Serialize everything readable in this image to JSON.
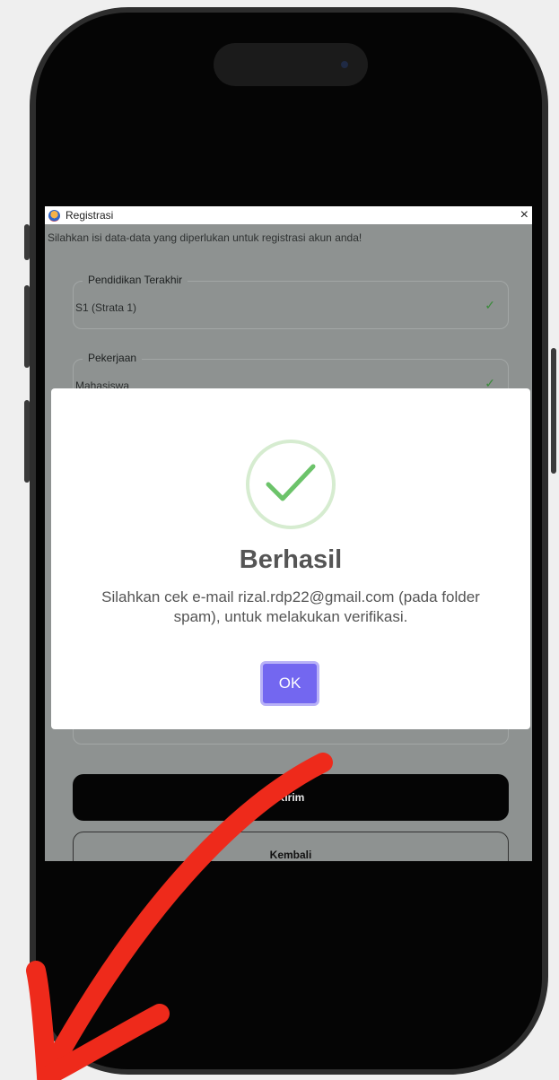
{
  "window": {
    "title": "Registrasi",
    "close_glyph": "×",
    "instruction": "Silahkan isi data-data yang diperlukan untuk registrasi akun anda!"
  },
  "form": {
    "fields": [
      {
        "label": "Pendidikan Terakhir",
        "value": "S1 (Strata 1)",
        "valid": true
      },
      {
        "label": "Pekerjaan",
        "value": "Mahasiswa",
        "valid": true
      }
    ],
    "check_glyph": "✓",
    "submit_label": "Kirim",
    "back_label": "Kembali"
  },
  "dialog": {
    "icon": "success-check-icon",
    "title": "Berhasil",
    "message": "Silahkan cek e-mail rizal.rdp22@gmail.com (pada folder spam), untuk melakukan verifikasi.",
    "ok_label": "OK"
  },
  "colors": {
    "overlay": "#8e9291",
    "dialog_button": "#7367f0",
    "success_green": "#6cc36a",
    "annotation_arrow": "#ee2a1b"
  }
}
